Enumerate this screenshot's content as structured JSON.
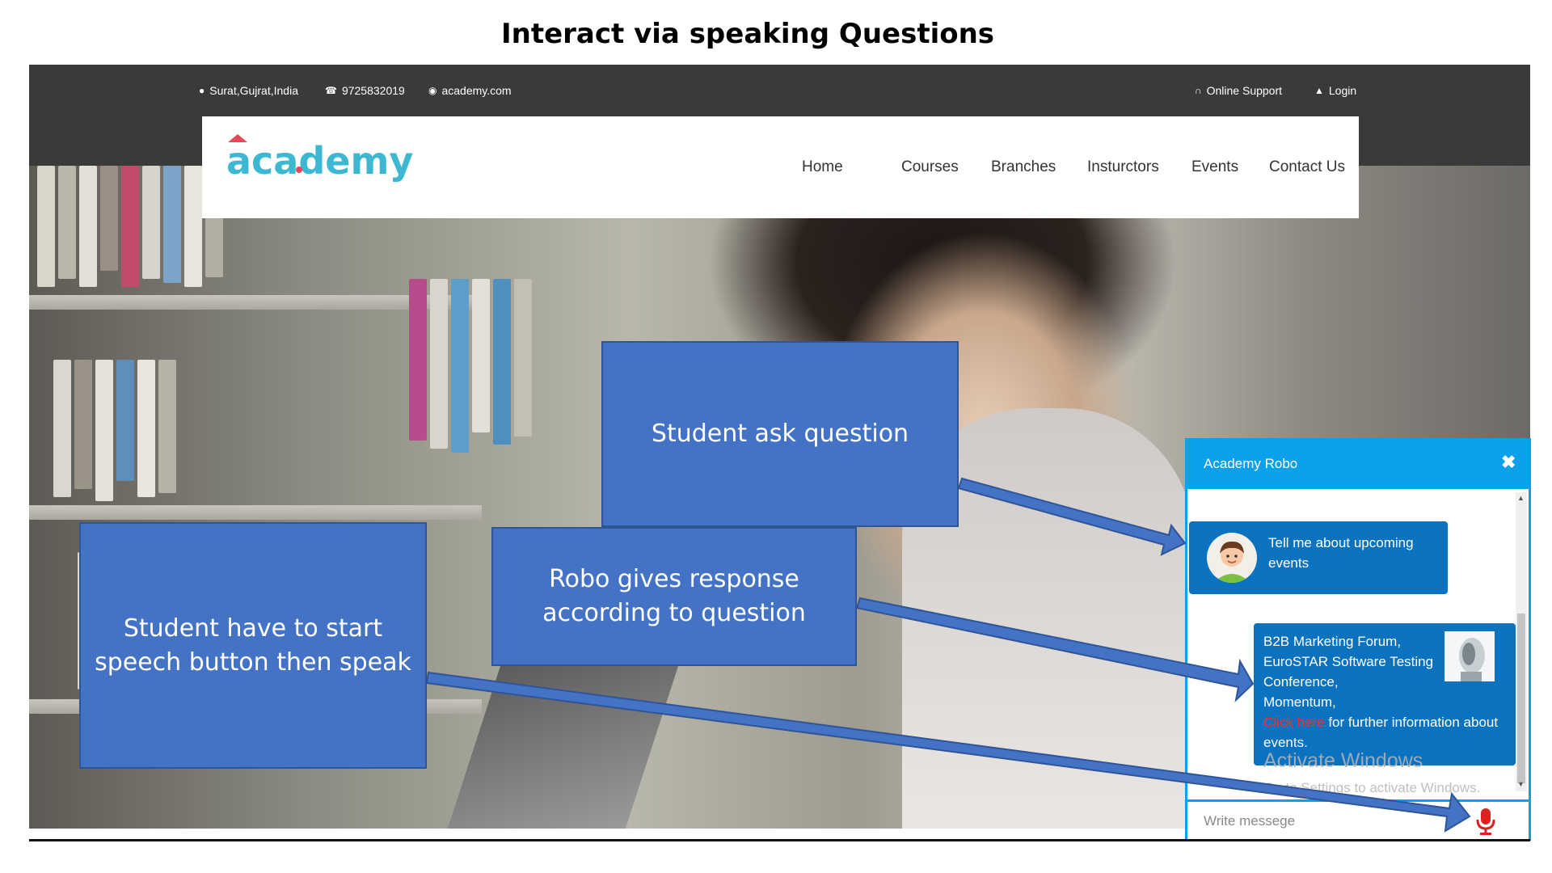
{
  "slide": {
    "title": "Interact via  speaking Questions"
  },
  "topbar": {
    "location": "Surat,Gujrat,India",
    "phone": "9725832019",
    "website": "academy.com",
    "support": "Online Support",
    "login": "Login"
  },
  "brand": {
    "logo": "academy"
  },
  "nav": {
    "items": [
      "Home",
      "Courses",
      "Branches",
      "Insturctors",
      "Events",
      "Contact Us"
    ]
  },
  "callouts": {
    "ask": "Student ask question",
    "response": "Robo gives response according to question",
    "speech": "Student have to start speech button then speak"
  },
  "chat": {
    "title": "Academy Robo",
    "close_icon": "✖",
    "user_message": "Tell me about upcoming events",
    "bot_message_lines": [
      "B2B Marketing Forum,",
      "EuroSTAR Software Testing Conference,",
      "Momentum,"
    ],
    "bot_link": "Click here",
    "bot_link_suffix": " for further information about events.",
    "input_placeholder": "Write messege",
    "watermark_title": "Activate Windows",
    "watermark_sub": "Go to Settings to activate Windows.",
    "accent_color": "#0aa0ea",
    "bubble_color": "#0a72bf",
    "mic_color": "#e02020"
  },
  "colors": {
    "callout_fill": "#4472c4",
    "callout_border": "#2f5597",
    "topbar_bg": "#3a3a3a",
    "logo_color": "#3db8d3"
  },
  "icons": {
    "location": "map-marker-icon",
    "phone": "phone-icon",
    "website": "globe-icon",
    "support": "headset-icon",
    "login": "user-icon",
    "close": "close-icon",
    "mic": "microphone-icon"
  }
}
